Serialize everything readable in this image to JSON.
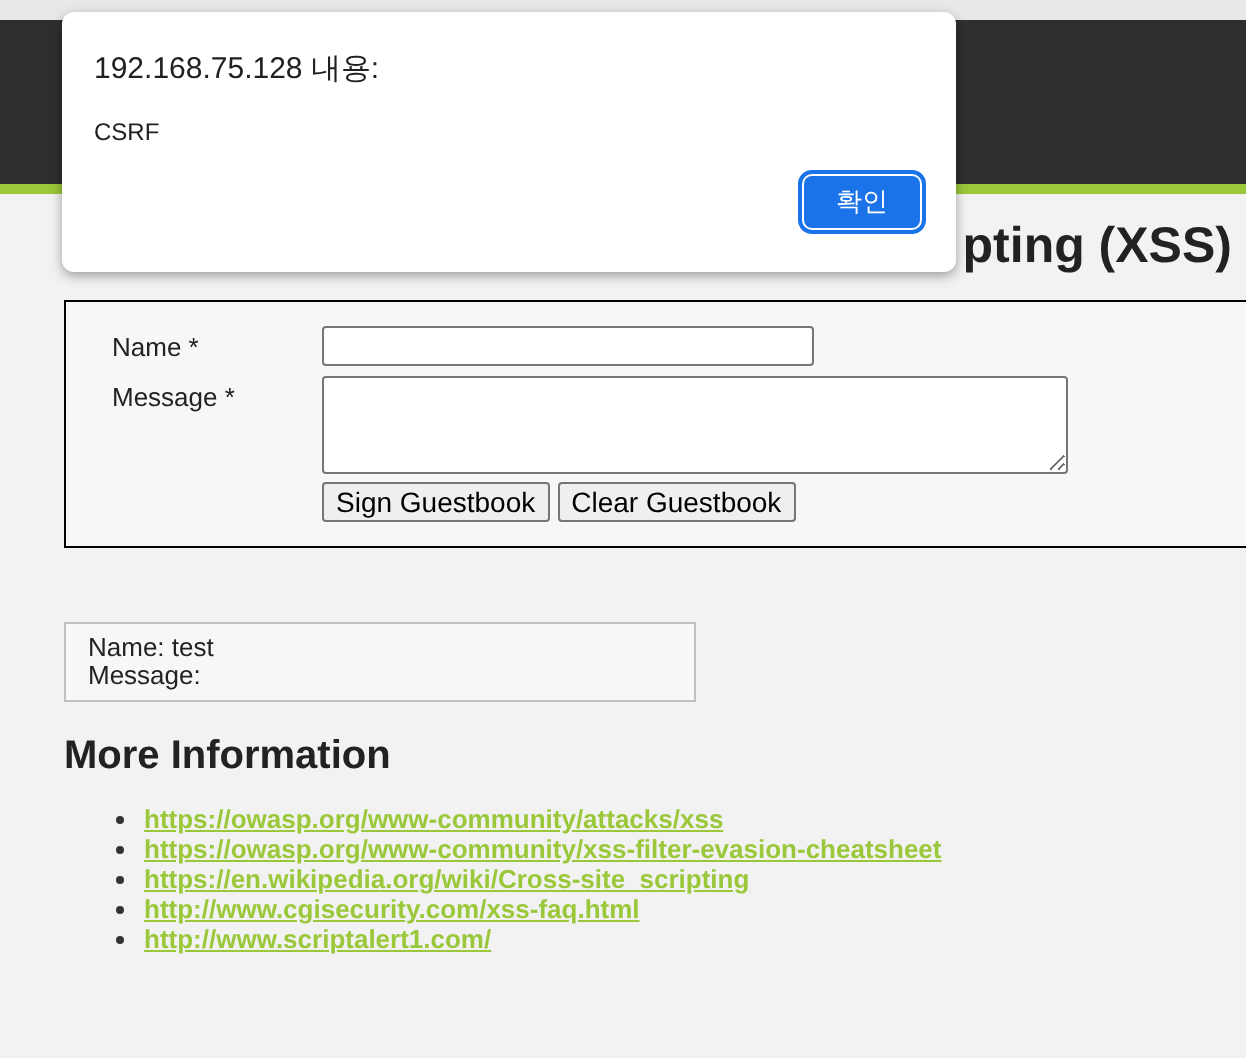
{
  "alert": {
    "title": "192.168.75.128 내용:",
    "message": "CSRF",
    "button": "확인"
  },
  "page_heading": "pting (XSS)",
  "form": {
    "fields": [
      {
        "label": "Name *",
        "kind": "input"
      },
      {
        "label": "Message *",
        "kind": "textarea"
      }
    ],
    "buttons": [
      "Sign Guestbook",
      "Clear Guestbook"
    ]
  },
  "entries": [
    {
      "name": "Name: test",
      "message": "Message:"
    }
  ],
  "more_info": {
    "heading": "More Information",
    "links": [
      "https://owasp.org/www-community/attacks/xss",
      "https://owasp.org/www-community/xss-filter-evasion-cheatsheet",
      "https://en.wikipedia.org/wiki/Cross-site_scripting",
      "http://www.cgisecurity.com/xss-faq.html",
      "http://www.scriptalert1.com/"
    ]
  }
}
